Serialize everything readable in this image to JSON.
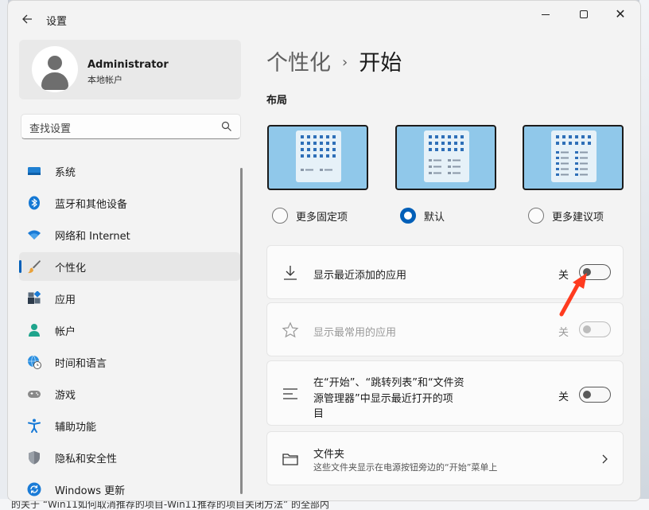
{
  "window": {
    "title": "设置"
  },
  "profile": {
    "name": "Administrator",
    "account_type": "本地帐户"
  },
  "search": {
    "placeholder": "查找设置"
  },
  "nav": {
    "items": [
      {
        "label": "系统",
        "icon": "system-icon"
      },
      {
        "label": "蓝牙和其他设备",
        "icon": "bluetooth-icon"
      },
      {
        "label": "网络和 Internet",
        "icon": "wifi-icon"
      },
      {
        "label": "个性化",
        "icon": "brush-icon",
        "active": true
      },
      {
        "label": "应用",
        "icon": "apps-icon"
      },
      {
        "label": "帐户",
        "icon": "account-icon"
      },
      {
        "label": "时间和语言",
        "icon": "globe-clock-icon"
      },
      {
        "label": "游戏",
        "icon": "gamepad-icon"
      },
      {
        "label": "辅助功能",
        "icon": "accessibility-icon"
      },
      {
        "label": "隐私和安全性",
        "icon": "shield-icon"
      },
      {
        "label": "Windows 更新",
        "icon": "update-icon"
      }
    ]
  },
  "breadcrumb": {
    "parent": "个性化",
    "separator": "›",
    "current": "开始"
  },
  "layout_section": {
    "title": "布局",
    "options": [
      {
        "label": "更多固定项",
        "selected": false
      },
      {
        "label": "默认",
        "selected": true
      },
      {
        "label": "更多建议项",
        "selected": false
      }
    ]
  },
  "settings": {
    "recent_apps": {
      "title": "显示最近添加的应用",
      "state_label": "关",
      "on": false,
      "enabled": true
    },
    "most_used": {
      "title": "显示最常用的应用",
      "state_label": "关",
      "on": false,
      "enabled": false
    },
    "recent_items": {
      "title_line1": "在“开始”、“跳转列表”和“文件资",
      "title_line2": "源管理器”中显示最近打开的项",
      "title_line3": "目",
      "state_label": "关",
      "on": false,
      "enabled": true
    },
    "folders": {
      "title": "文件夹",
      "subtitle": "这些文件夹显示在电源按钮旁边的“开始”菜单上"
    }
  },
  "background": {
    "bottom_text": "的关于 “Win11如何取消推荐的项目-Win11推荐的项目关闭方法” 的全部内"
  },
  "colors": {
    "accent": "#005fb8",
    "annotation_arrow": "#ff3b1f"
  }
}
